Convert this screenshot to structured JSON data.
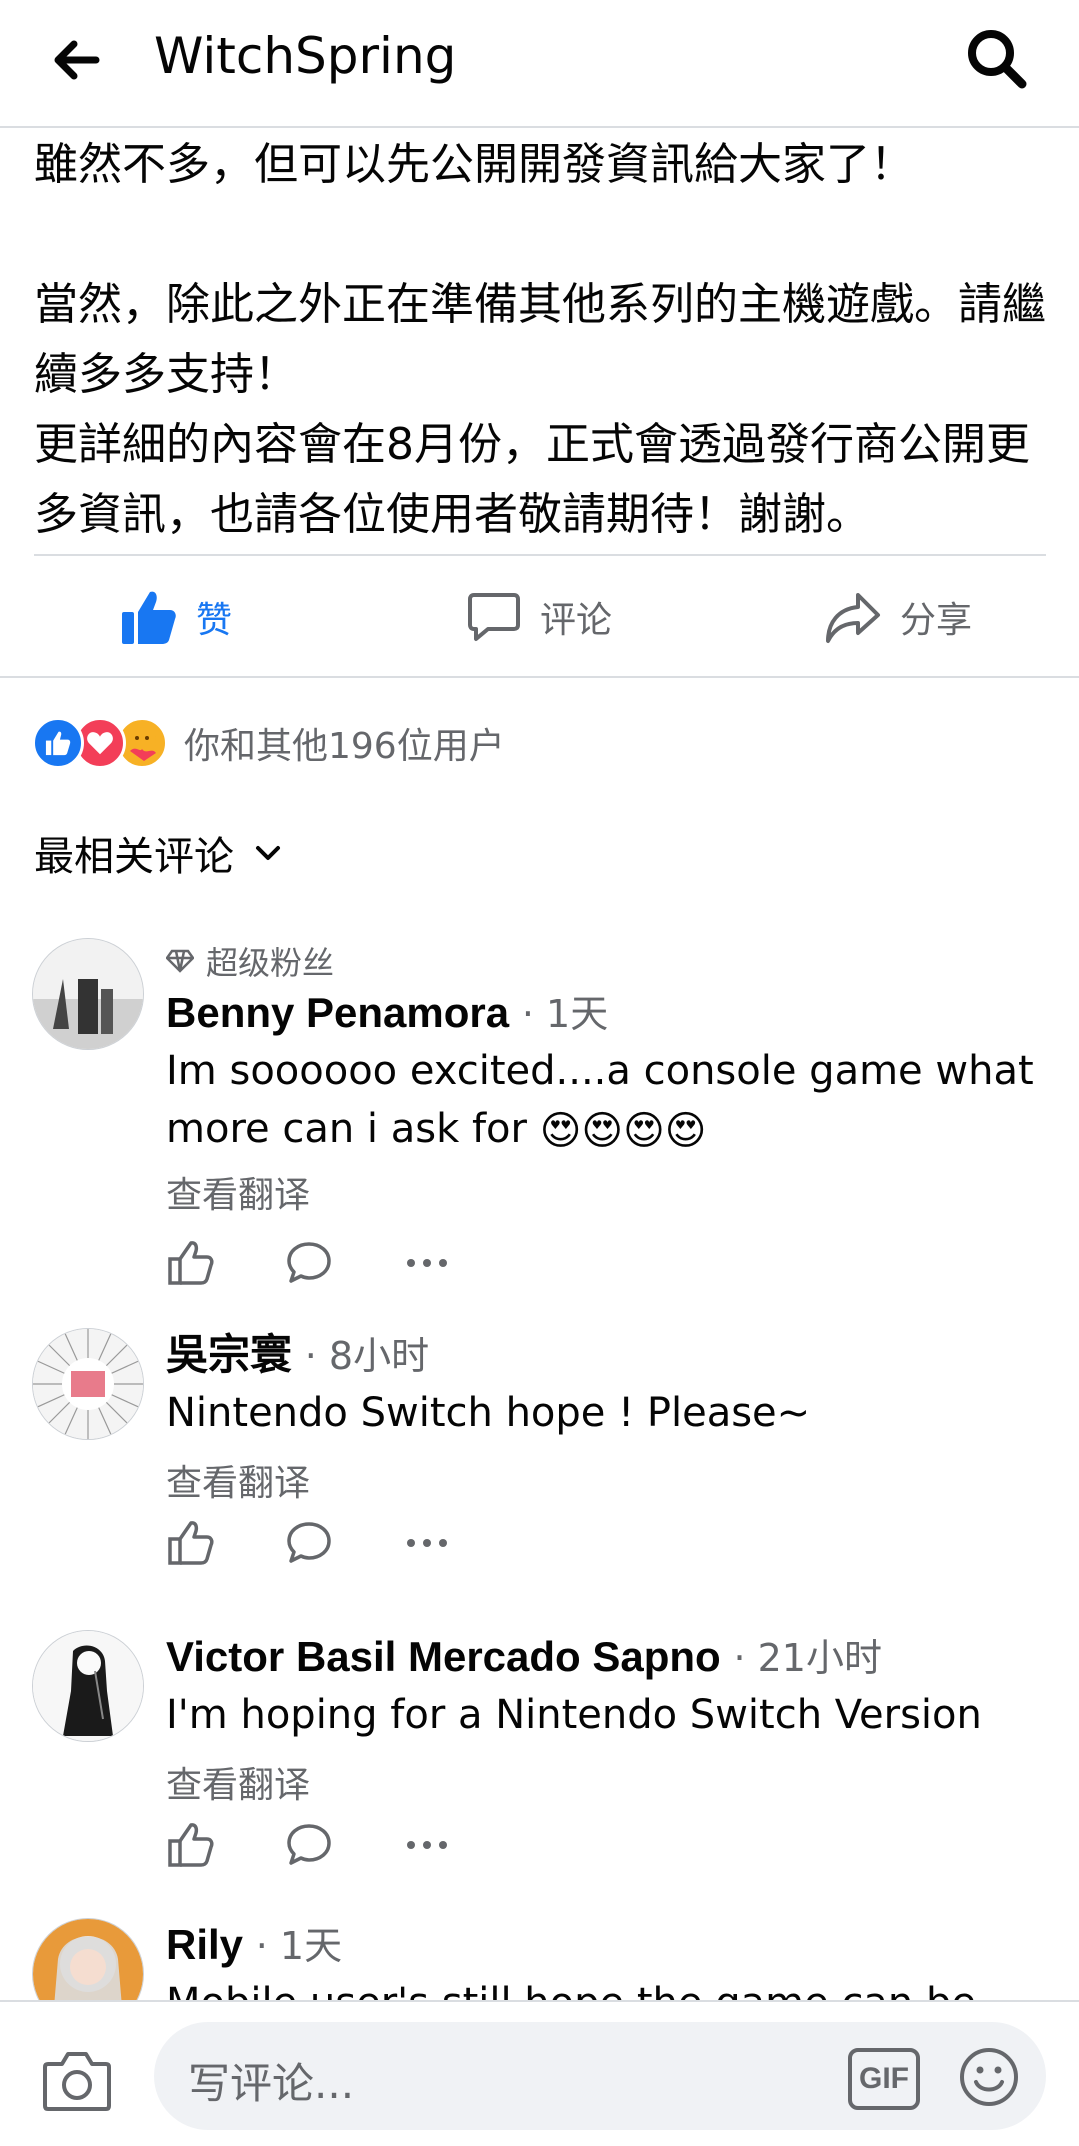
{
  "header": {
    "back_icon": "arrow-left-icon",
    "title": "WitchSpring",
    "search_icon": "search-icon"
  },
  "post": {
    "text": "雖然不多，但可以先公開開發資訊給大家了！\n\n當然，除此之外正在準備其他系列的主機遊戲。請繼續多多支持！\n更詳細的內容會在8月份，正式會透過發行商公開更多資訊，也請各位使用者敬請期待！謝謝。",
    "actions": {
      "like_label": "赞",
      "comment_label": "评论",
      "share_label": "分享"
    },
    "reactions_summary": "你和其他196位用户"
  },
  "comments_sort_label": "最相关评论",
  "comments": [
    {
      "badge": "超级粉丝",
      "name": "Benny Penamora",
      "time": "1天",
      "text": "Im soooooo excited....a console game what more can i ask for",
      "emojis": "😍😍😍😍",
      "translate": "查看翻译"
    },
    {
      "name": "吳宗寰",
      "time": "8小时",
      "text": "Nintendo Switch hope ! Please~",
      "translate": "查看翻译"
    },
    {
      "name": "Victor Basil Mercado Sapno",
      "time": "21小时",
      "text": "I'm hoping for a Nintendo Switch Version",
      "translate": "查看翻译"
    },
    {
      "name": "Rily",
      "time": "1天",
      "text": "Mobile user's still hope the game can be"
    }
  ],
  "composer": {
    "placeholder": "写评论...",
    "gif_label": "GIF"
  },
  "colors": {
    "accent": "#1877f2",
    "secondary_text": "#65676b",
    "divider": "#dadde1",
    "love": "#f33e58"
  }
}
